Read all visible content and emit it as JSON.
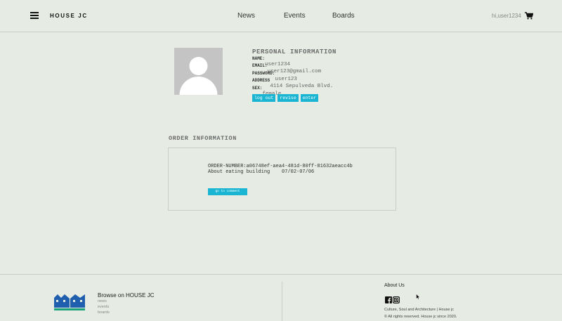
{
  "header": {
    "brand": "HOUSE JC",
    "nav": [
      "News",
      "Events",
      "Boards"
    ],
    "greeting": "hi,user1234"
  },
  "profile": {
    "title": "PERSONAL INFORMATION",
    "fields": [
      {
        "key": "NAME:",
        "value": "user1234"
      },
      {
        "key": "EMAIL:",
        "value": "user123@gmail.com"
      },
      {
        "key": "PASSWORD:",
        "value": "user123"
      },
      {
        "key": "ADDRESS",
        "value": "4114 Sepulveda Blvd."
      },
      {
        "key": "SEX:",
        "value": "female"
      }
    ],
    "buttons": [
      "log out",
      "revise",
      "enter"
    ]
  },
  "order": {
    "title": "ORDER INFORMATION",
    "number_line": "ORDER-NUMBER:a06748ef-aea4-481d-80ff-81632aeacc4b",
    "detail_line": "About eating building    07/02-07/06",
    "comment_button": "go to comment"
  },
  "footer": {
    "browse_title": "Browse on HOUSE JC",
    "links": [
      "news",
      "events",
      "boards"
    ],
    "about_title": "About Us",
    "tagline": "Culture, Soul and Architecture | House jc",
    "copyright": "© All rights reserved. House jc since 2020."
  },
  "colors": {
    "background": "#e6ebe3",
    "accent": "#19b5d2",
    "logo_blue": "#1f5fae",
    "logo_green": "#1aa37a"
  },
  "icons": [
    "hamburger-menu-icon",
    "cart-icon",
    "facebook-icon",
    "instagram-icon",
    "house-logo-icon",
    "cursor-icon"
  ]
}
